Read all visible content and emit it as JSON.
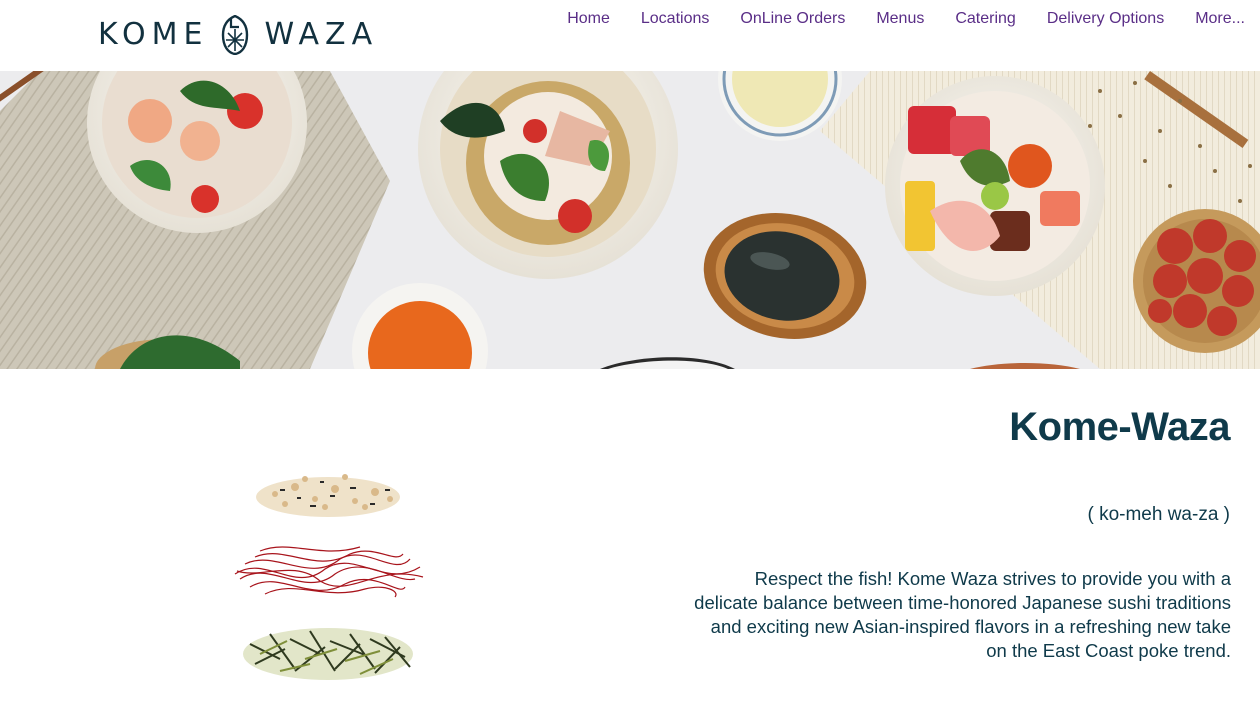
{
  "header": {
    "logo": {
      "left_word": "KOME",
      "right_word": "WAZA"
    },
    "nav": [
      {
        "label": "Home"
      },
      {
        "label": "Locations"
      },
      {
        "label": "OnLine Orders"
      },
      {
        "label": "Menus"
      },
      {
        "label": "Catering"
      },
      {
        "label": "Delivery Options"
      },
      {
        "label": "More..."
      }
    ]
  },
  "main": {
    "title": "Kome-Waza",
    "pronunciation": "( ko-meh wa-za )",
    "description": "Respect the fish! Kome Waza strives to provide you with a delicate balance between time-honored Japanese sushi traditions and exciting new Asian-inspired flavors in a refreshing new take on the East Coast poke trend."
  },
  "colors": {
    "brand_dark": "#0f3a4a",
    "nav_link": "#5a2e87",
    "background": "#ffffff"
  }
}
